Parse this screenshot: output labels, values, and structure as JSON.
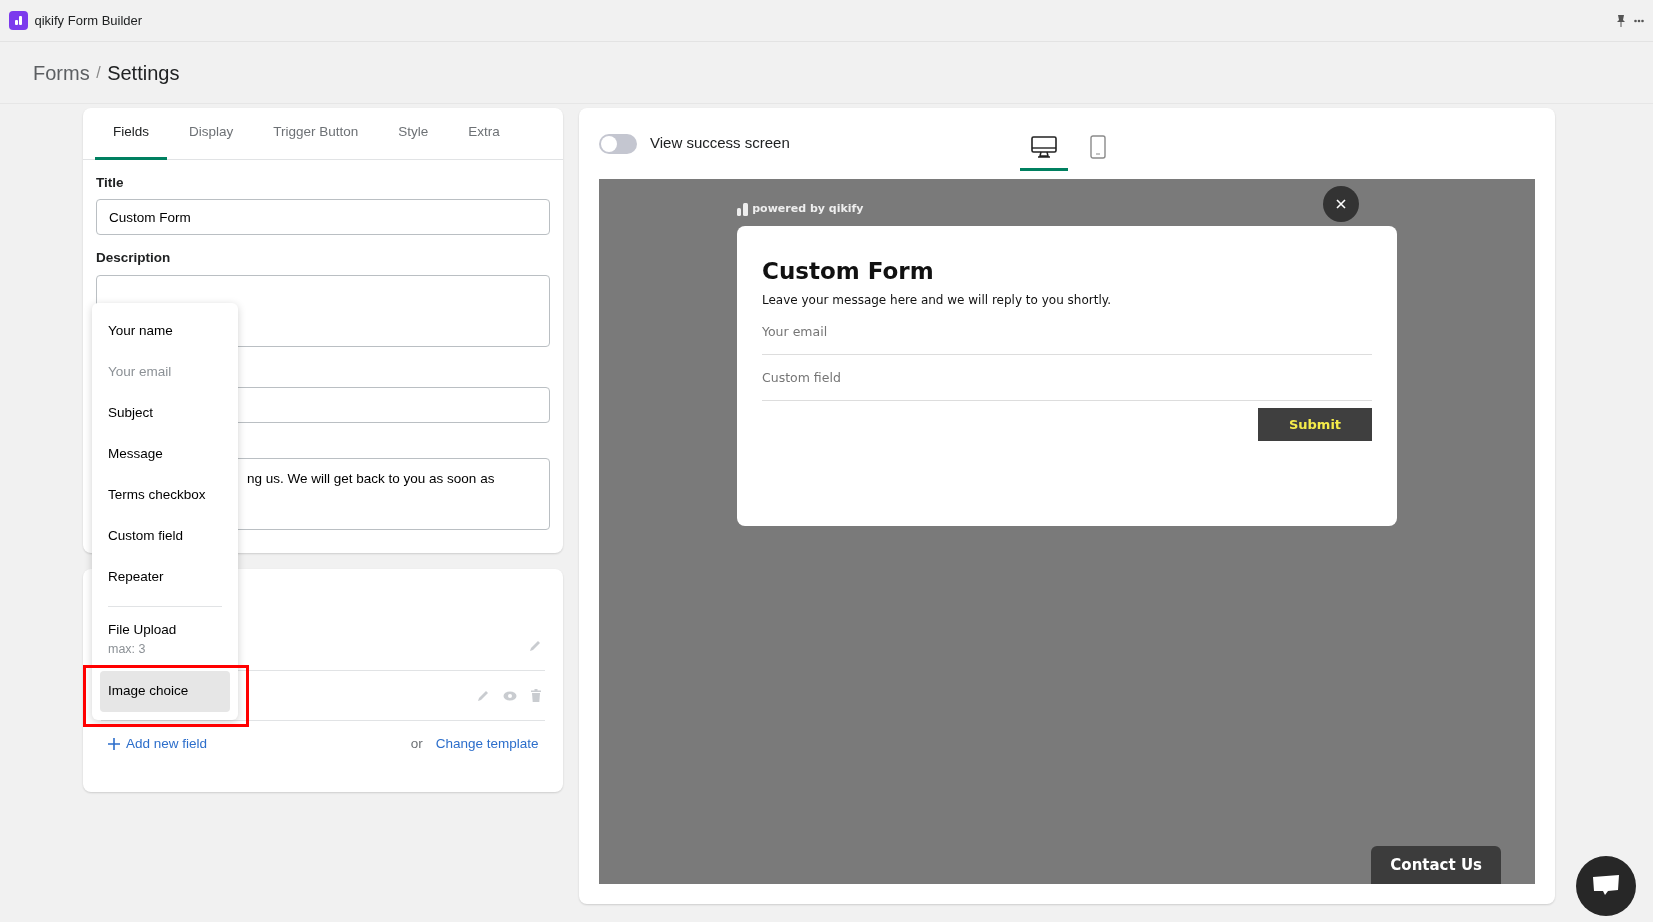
{
  "app": {
    "title": "qikify Form Builder"
  },
  "breadcrumb": {
    "items": [
      "Forms",
      "Settings"
    ],
    "separator": "/"
  },
  "settings_tabs": [
    {
      "label": "Fields",
      "selected": true
    },
    {
      "label": "Display",
      "selected": false
    },
    {
      "label": "Trigger Button",
      "selected": false
    },
    {
      "label": "Style",
      "selected": false
    },
    {
      "label": "Extra",
      "selected": false
    }
  ],
  "form_settings": [
    {
      "kind": "input",
      "label": "Title",
      "value": "Custom Form"
    },
    {
      "kind": "textarea",
      "label": "Description"
    },
    {
      "kind": "input"
    },
    {
      "kind": "textarea",
      "value": "ng us. We will get back to you as soon as"
    }
  ],
  "fields_card": {
    "rows": [
      {
        "kind": "locked"
      },
      {
        "kind": "custom"
      }
    ],
    "add_field": "Add new field",
    "or_text": "or",
    "change_template": "Change template"
  },
  "field_menu": {
    "items": [
      {
        "label": "Your name",
        "disabled": false,
        "selected": false
      },
      {
        "label": "Your email",
        "disabled": true,
        "selected": false
      },
      {
        "label": "Subject",
        "disabled": false,
        "selected": false
      },
      {
        "label": "Message",
        "disabled": false,
        "selected": false
      },
      {
        "label": "Terms checkbox",
        "disabled": false,
        "selected": false
      },
      {
        "label": "Custom field",
        "disabled": false,
        "selected": false
      },
      {
        "label": "Repeater",
        "disabled": false,
        "selected": false
      },
      {
        "label": "File Upload",
        "note": "max: 3",
        "divider_before": true,
        "disabled": false,
        "selected": false
      },
      {
        "label": "Image choice",
        "disabled": false,
        "selected": true
      }
    ]
  },
  "preview": {
    "success_toggle": {
      "label": "View success screen",
      "on": false
    },
    "devices": [
      {
        "kind": "desktop",
        "selected": true
      },
      {
        "kind": "mobile",
        "selected": false
      }
    ],
    "branding": "powered by qikify",
    "form": {
      "title": "Custom Form",
      "description": "Leave your message here and we will reply to you shortly.",
      "fields": [
        {
          "placeholder": "Your email"
        },
        {
          "placeholder": "Custom field"
        }
      ],
      "submit": "Submit"
    },
    "trigger_button": "Contact Us"
  }
}
